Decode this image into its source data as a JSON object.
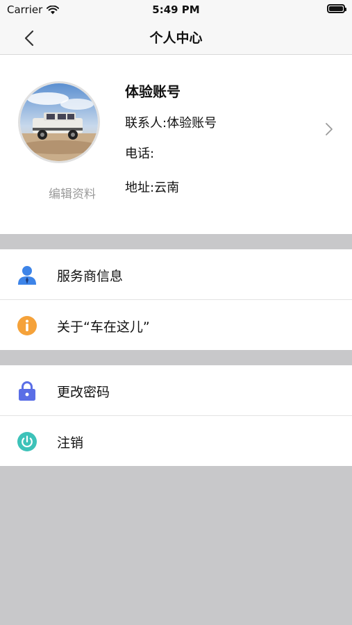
{
  "status": {
    "carrier": "Carrier",
    "time": "5:49 PM"
  },
  "nav": {
    "title": "个人中心"
  },
  "profile": {
    "account_name": "体验账号",
    "contact": "联系人:体验账号",
    "phone": "电话:",
    "address": "地址:云南",
    "edit_label": "编辑资料"
  },
  "menu": [
    {
      "label": "服务商信息",
      "icon": "person-icon",
      "color": "#3d84e8"
    },
    {
      "label": "关于“车在这儿”",
      "icon": "info-icon",
      "color": "#f5a23a"
    },
    {
      "label": "更改密码",
      "icon": "lock-icon",
      "color": "#5a6ee6"
    },
    {
      "label": "注销",
      "icon": "power-icon",
      "color": "#3dc2b9"
    }
  ]
}
